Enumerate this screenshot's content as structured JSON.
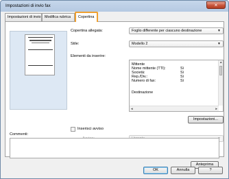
{
  "window": {
    "title": "Impostazioni di invio fax"
  },
  "tabs": [
    {
      "label": "Impostazioni di invio"
    },
    {
      "label": "Modifica rubrica"
    },
    {
      "label": "Copertina"
    }
  ],
  "form": {
    "cover_label": "Copertina allegata:",
    "cover_value": "Foglio differente per ciascuno destinazione",
    "style_label": "Stile:",
    "style_value": "Modello 2",
    "elements_label": "Elementi da inserire:",
    "elements": [
      {
        "name": "Mittente",
        "value": ""
      },
      {
        "name": "Nome mittente (TTI):",
        "value": "Sì"
      },
      {
        "name": "Società:",
        "value": "Sì"
      },
      {
        "name": "Rep./Div.:",
        "value": "Sì"
      },
      {
        "name": "Numero di fax:",
        "value": "Sì"
      },
      {
        "name": "Destinazione",
        "value": ""
      }
    ],
    "settings_button": "Impostazioni...",
    "notice_checkbox": "Inserisci avviso",
    "notice_label": "Avviso:",
    "notice_value": "Urgente",
    "comments_label": "Commenti:",
    "preview_button": "Anteprima"
  },
  "footer": {
    "ok": "OK",
    "cancel": "Annulla",
    "help": "?"
  },
  "icons": {
    "close": "×",
    "dropdown": "▼",
    "up": "▲",
    "left": "◄",
    "right": "►"
  },
  "colors": {
    "active_tab_outline": "#f0a030",
    "title_bar": "#c6d7eb",
    "close_button": "#c7543a",
    "preview_bg": "#dde8f4"
  }
}
